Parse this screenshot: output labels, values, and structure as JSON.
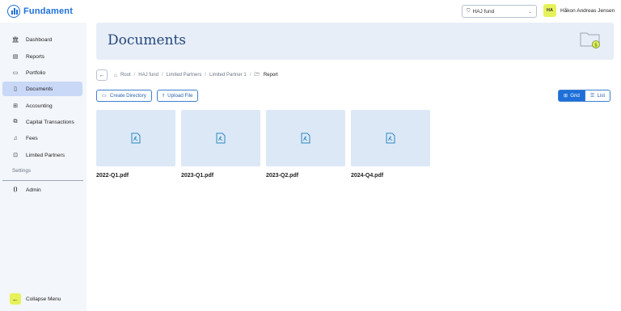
{
  "app": {
    "name": "Fundament"
  },
  "header": {
    "fund_select": {
      "value": "HAJ fund"
    },
    "user": {
      "initials": "HA",
      "name": "Håkon Andreas Jensen"
    }
  },
  "sidebar": {
    "items": [
      {
        "label": "Dashboard",
        "icon": "bank-icon"
      },
      {
        "label": "Reports",
        "icon": "table-icon"
      },
      {
        "label": "Portfolio",
        "icon": "id-card-icon"
      },
      {
        "label": "Documents",
        "icon": "document-icon",
        "active": true
      },
      {
        "label": "Accounting",
        "icon": "calculator-icon"
      },
      {
        "label": "Capital Transactions",
        "icon": "transactions-icon"
      },
      {
        "label": "Fees",
        "icon": "bell-icon"
      },
      {
        "label": "Limited Partners",
        "icon": "lock-icon"
      }
    ],
    "settings_label": "Settings",
    "admin_item": {
      "label": "Admin",
      "icon": "admin-icon"
    },
    "collapse_label": "Collapse Menu"
  },
  "page": {
    "title": "Documents"
  },
  "breadcrumb": {
    "items": [
      "Root",
      "HAJ fund",
      "Limited Partners",
      "Limited Partner 1",
      "Report"
    ],
    "separator": "/"
  },
  "toolbar": {
    "create_dir_label": "Create Directory",
    "upload_label": "Upload File",
    "view_grid_label": "Grid",
    "view_list_label": "List"
  },
  "files": [
    {
      "name": "2022-Q1.pdf"
    },
    {
      "name": "2023-Q1.pdf"
    },
    {
      "name": "2023-Q2.pdf"
    },
    {
      "name": "2024-Q4.pdf"
    }
  ],
  "colors": {
    "accent": "#1e6fd9",
    "active_nav": "#c9d8f7",
    "tile_bg": "#dde8f7",
    "avatar_bg": "#e6f25a"
  }
}
